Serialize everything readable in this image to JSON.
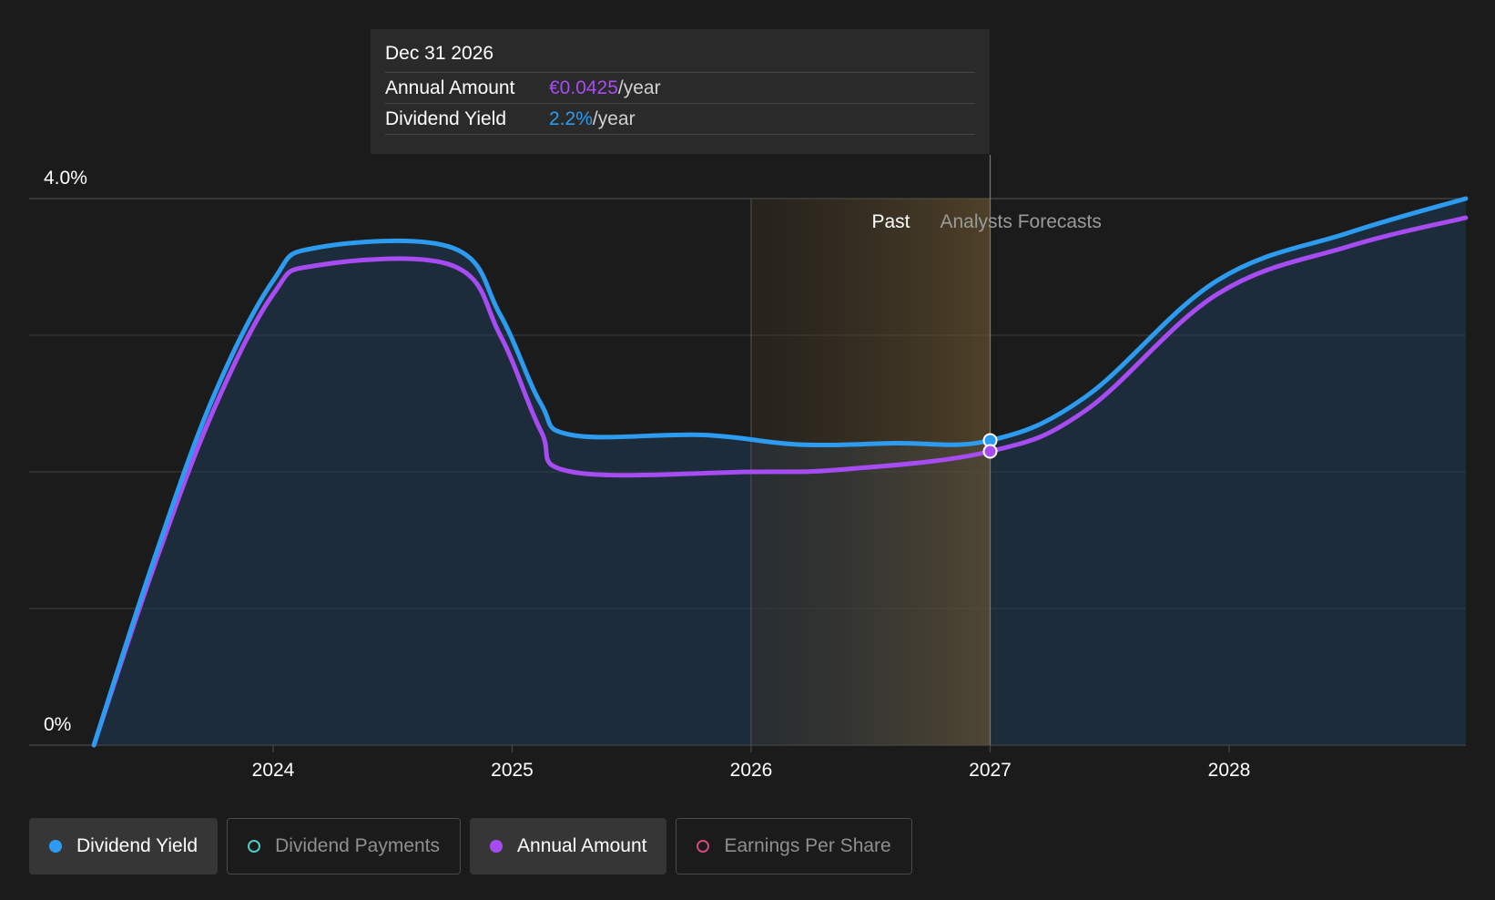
{
  "tooltip": {
    "date": "Dec 31 2026",
    "rows": [
      {
        "label": "Annual Amount",
        "value": "€0.0425",
        "unit": "/year"
      },
      {
        "label": "Dividend Yield",
        "value": "2.2%",
        "unit": "/year"
      }
    ]
  },
  "legend": [
    {
      "label": "Dividend Yield",
      "color": "#2d9bf0",
      "active": true,
      "filled": true
    },
    {
      "label": "Dividend Payments",
      "color": "#4ecdc4",
      "active": false,
      "filled": false
    },
    {
      "label": "Annual Amount",
      "color": "#a64cf2",
      "active": true,
      "filled": true
    },
    {
      "label": "Earnings Per Share",
      "color": "#d4477d",
      "active": false,
      "filled": false
    }
  ],
  "chart_data": {
    "type": "line",
    "y_tick_labels": [
      "4.0%",
      "0%"
    ],
    "ylim": [
      0,
      4.0
    ],
    "x_tick_labels": [
      "2024",
      "2025",
      "2026",
      "2027",
      "2028"
    ],
    "xlim": [
      2023.25,
      2028.99
    ],
    "grid": true,
    "region_labels": {
      "past": "Past",
      "forecast": "Analysts Forecasts"
    },
    "past_highlight_range": [
      2026.0,
      2027.0
    ],
    "marker_x": 2027.0,
    "series": [
      {
        "name": "Dividend Yield",
        "color": "#2d9bf0",
        "points": [
          [
            2023.25,
            0.0
          ],
          [
            2023.5,
            1.35
          ],
          [
            2023.75,
            2.55
          ],
          [
            2024.0,
            3.4
          ],
          [
            2024.18,
            3.64
          ],
          [
            2024.75,
            3.64
          ],
          [
            2024.95,
            3.15
          ],
          [
            2025.12,
            2.5
          ],
          [
            2025.25,
            2.27
          ],
          [
            2025.8,
            2.27
          ],
          [
            2026.2,
            2.2
          ],
          [
            2026.6,
            2.21
          ],
          [
            2027.0,
            2.23
          ],
          [
            2027.4,
            2.55
          ],
          [
            2027.95,
            3.4
          ],
          [
            2028.5,
            3.75
          ],
          [
            2028.99,
            4.0
          ]
        ]
      },
      {
        "name": "Annual Amount",
        "color": "#a64cf2",
        "points": [
          [
            2023.25,
            0.0
          ],
          [
            2023.5,
            1.3
          ],
          [
            2023.75,
            2.45
          ],
          [
            2024.0,
            3.3
          ],
          [
            2024.18,
            3.51
          ],
          [
            2024.75,
            3.51
          ],
          [
            2024.95,
            3.0
          ],
          [
            2025.12,
            2.3
          ],
          [
            2025.25,
            2.0
          ],
          [
            2026.0,
            2.0
          ],
          [
            2026.4,
            2.02
          ],
          [
            2027.0,
            2.15
          ],
          [
            2027.4,
            2.45
          ],
          [
            2027.95,
            3.3
          ],
          [
            2028.5,
            3.65
          ],
          [
            2028.99,
            3.86
          ]
        ]
      }
    ]
  }
}
